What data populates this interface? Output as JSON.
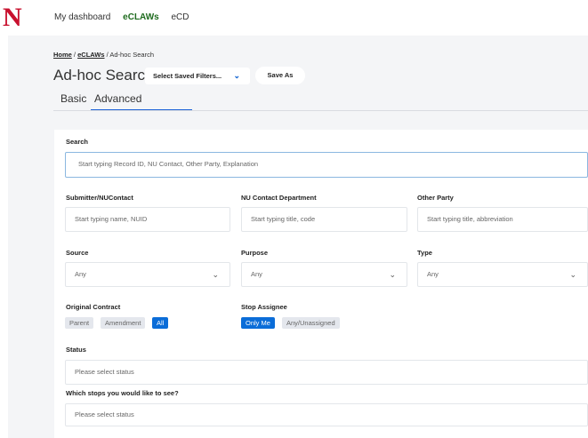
{
  "topbar": {
    "logo": "N",
    "nav": [
      "My dashboard",
      "eCLAWs",
      "eCD"
    ],
    "active": "eCLAWs"
  },
  "breadcrumb": {
    "home": "Home",
    "sep1": " / ",
    "eclaws": "eCLAWs",
    "sep2": " / ",
    "current": "Ad-hoc Search"
  },
  "header": {
    "title": "Ad-hoc Search",
    "saved_filters": "Select Saved Filters...",
    "save_as": "Save As"
  },
  "tabs": {
    "basic": "Basic",
    "advanced": "Advanced",
    "active": "Advanced"
  },
  "form": {
    "search": {
      "label": "Search",
      "placeholder": "Start typing Record ID, NU Contact, Other Party, Explanation"
    },
    "submitter": {
      "label": "Submitter/NUContact",
      "placeholder": "Start typing name, NUID"
    },
    "department": {
      "label": "NU Contact Department",
      "placeholder": "Start typing title, code"
    },
    "other_party": {
      "label": "Other Party",
      "placeholder": "Start typing title, abbreviation"
    },
    "source": {
      "label": "Source",
      "value": "Any"
    },
    "purpose": {
      "label": "Purpose",
      "value": "Any"
    },
    "type": {
      "label": "Type",
      "value": "Any"
    },
    "original_contract": {
      "label": "Original Contract",
      "options": [
        "Parent",
        "Amendment",
        "All"
      ],
      "selected": "All"
    },
    "stop_assignee": {
      "label": "Stop Assignee",
      "options": [
        "Only Me",
        "Any/Unassigned"
      ],
      "selected": "Only Me"
    },
    "status": {
      "label": "Status",
      "placeholder": "Please select status"
    },
    "stops": {
      "label": "Which stops you would like to see?",
      "placeholder": "Please select status"
    }
  },
  "colors": {
    "accent": "#1d63d8",
    "brand": "#c8102e",
    "active_nav": "#1e6b1e"
  }
}
